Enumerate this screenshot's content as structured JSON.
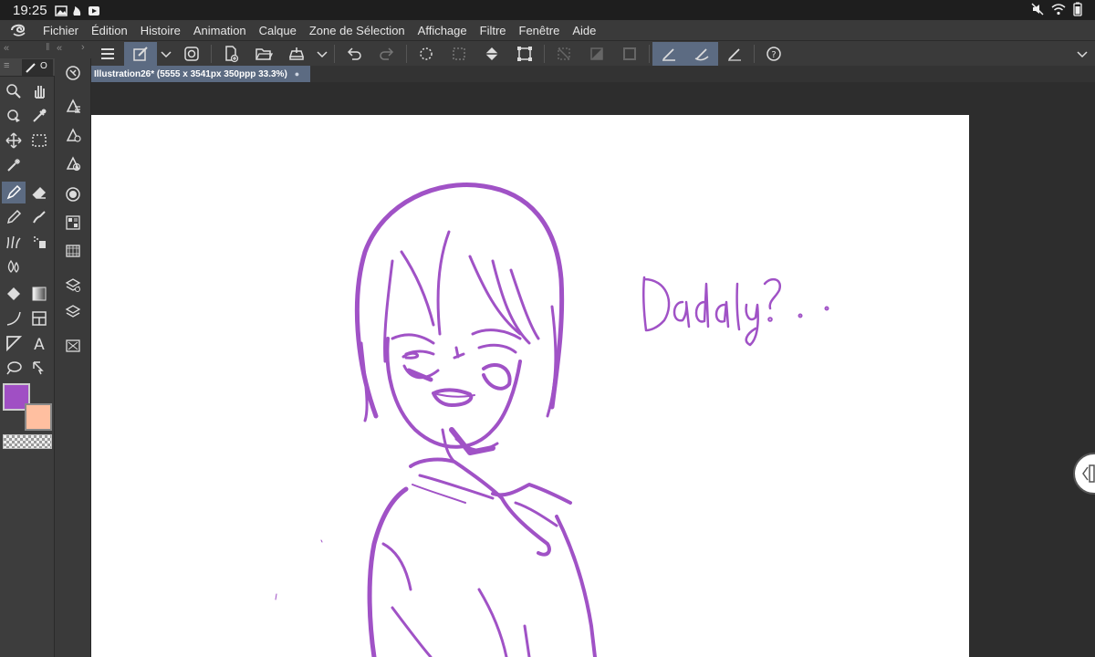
{
  "status_bar": {
    "time": "19:25",
    "icons": [
      "gallery-icon",
      "flame-icon",
      "video-icon"
    ],
    "right_icons": [
      "mute-icon",
      "wifi-icon",
      "battery-icon"
    ]
  },
  "menu": {
    "items": [
      "Fichier",
      "Édition",
      "Histoire",
      "Animation",
      "Calque",
      "Zone de Sélection",
      "Affichage",
      "Filtre",
      "Fenêtre",
      "Aide"
    ]
  },
  "left_nav": {
    "collapse_left": "«",
    "collapse_left2": "«",
    "expand": "›"
  },
  "tool_panel": {
    "tab_label": "O",
    "main_color": "#a04fc4",
    "sub_color": "#ffbfa0"
  },
  "document": {
    "tab_title": "Illustration26* (5555 x 3541px 350ppp 33.3%)",
    "tab_close": "●"
  },
  "canvas": {
    "handwriting": "Dadaly ? . .",
    "stroke_color": "#a052c6"
  }
}
